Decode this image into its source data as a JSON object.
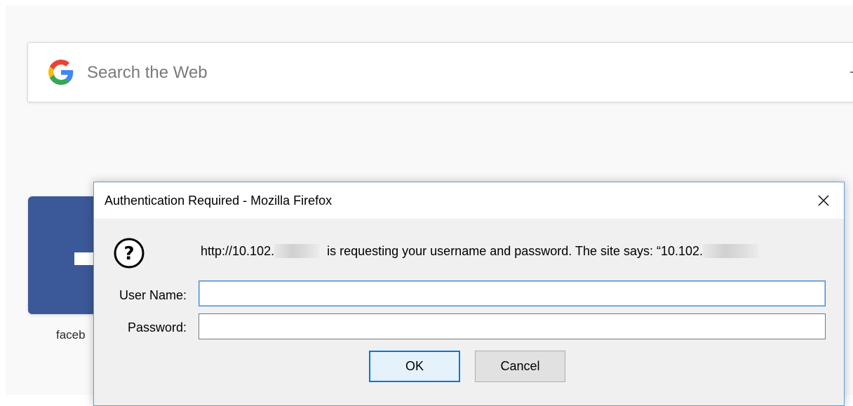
{
  "new_tab": {
    "search_placeholder": "Search the Web",
    "search_engine_icon": "google-g-icon",
    "top_site_tile": {
      "label": "faceb",
      "color": "#3b5998"
    }
  },
  "dialog": {
    "title": "Authentication Required - Mozilla Firefox",
    "close_icon": "close-icon",
    "prompt_icon": "question-mark-icon",
    "message_prefix": "http://10.102.",
    "message_middle": " is requesting your username and password. The site says: “10.102.",
    "username_label": "User Name:",
    "username_value": "",
    "password_label": "Password:",
    "password_value": "",
    "ok_label": "OK",
    "cancel_label": "Cancel",
    "accent_color": "#0078d7"
  }
}
